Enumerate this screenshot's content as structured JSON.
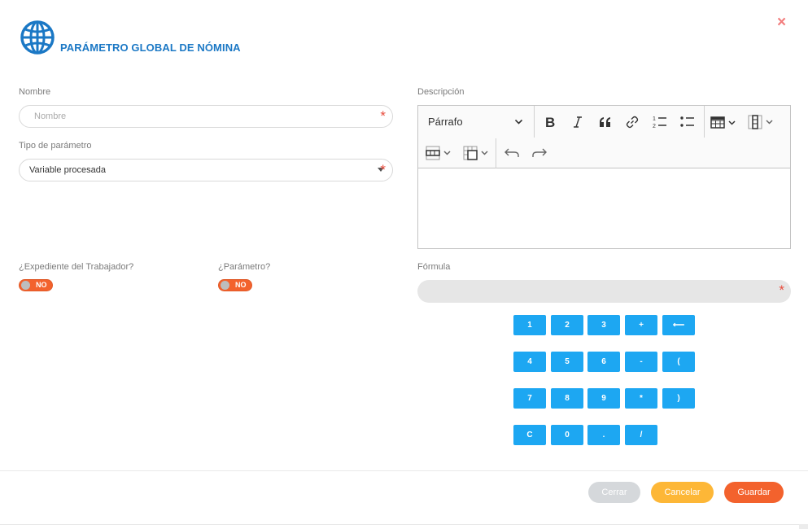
{
  "header": {
    "title": "PARÁMETRO GLOBAL DE NÓMINA",
    "close_label": "×"
  },
  "nombre": {
    "label": "Nombre",
    "placeholder": "Nombre",
    "required_mark": "*"
  },
  "tipo": {
    "label": "Tipo de parámetro",
    "value": "Variable procesada",
    "required_mark": "*"
  },
  "descripcion": {
    "label": "Descripción",
    "block_format": "Párrafo"
  },
  "expediente": {
    "label": "¿Expediente del Trabajador?",
    "toggle": "NO"
  },
  "parametro": {
    "label": "¿Parámetro?",
    "toggle": "NO"
  },
  "formula": {
    "label": "Fórmula",
    "required_mark": "*"
  },
  "keypad": {
    "keys": [
      "1",
      "2",
      "3",
      "+",
      "⟵",
      "4",
      "5",
      "6",
      "-",
      "(",
      "7",
      "8",
      "9",
      "*",
      ")",
      "C",
      "0",
      ".",
      "/"
    ]
  },
  "footer": {
    "close": "Cerrar",
    "cancel": "Cancelar",
    "save": "Guardar"
  },
  "colors": {
    "accent_blue": "#1b78c5",
    "key_blue": "#1da7f2",
    "orange": "#f3622d",
    "yellow": "#fdb737",
    "grey_btn": "#d5d8db"
  }
}
